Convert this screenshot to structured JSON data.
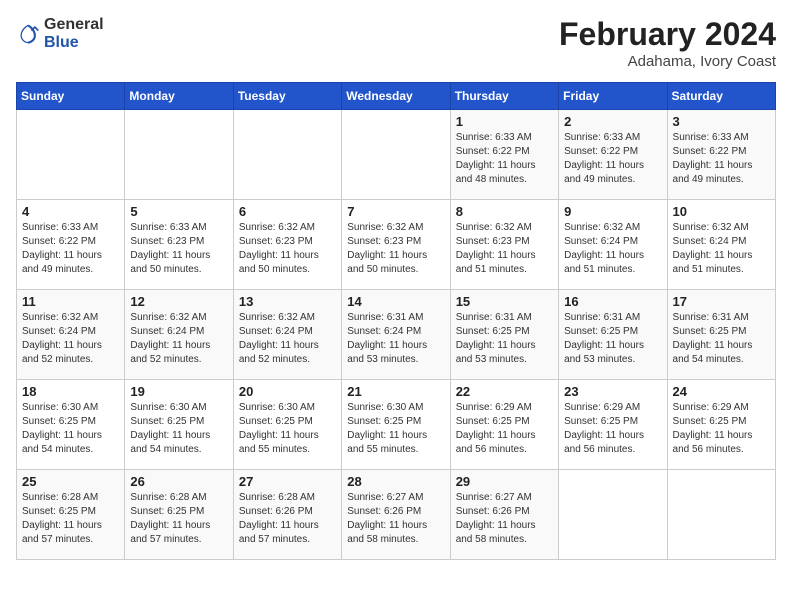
{
  "header": {
    "logo_general": "General",
    "logo_blue": "Blue",
    "month_year": "February 2024",
    "location": "Adahama, Ivory Coast"
  },
  "weekdays": [
    "Sunday",
    "Monday",
    "Tuesday",
    "Wednesday",
    "Thursday",
    "Friday",
    "Saturday"
  ],
  "weeks": [
    [
      {
        "day": "",
        "info": ""
      },
      {
        "day": "",
        "info": ""
      },
      {
        "day": "",
        "info": ""
      },
      {
        "day": "",
        "info": ""
      },
      {
        "day": "1",
        "info": "Sunrise: 6:33 AM\nSunset: 6:22 PM\nDaylight: 11 hours\nand 48 minutes."
      },
      {
        "day": "2",
        "info": "Sunrise: 6:33 AM\nSunset: 6:22 PM\nDaylight: 11 hours\nand 49 minutes."
      },
      {
        "day": "3",
        "info": "Sunrise: 6:33 AM\nSunset: 6:22 PM\nDaylight: 11 hours\nand 49 minutes."
      }
    ],
    [
      {
        "day": "4",
        "info": "Sunrise: 6:33 AM\nSunset: 6:22 PM\nDaylight: 11 hours\nand 49 minutes."
      },
      {
        "day": "5",
        "info": "Sunrise: 6:33 AM\nSunset: 6:23 PM\nDaylight: 11 hours\nand 50 minutes."
      },
      {
        "day": "6",
        "info": "Sunrise: 6:32 AM\nSunset: 6:23 PM\nDaylight: 11 hours\nand 50 minutes."
      },
      {
        "day": "7",
        "info": "Sunrise: 6:32 AM\nSunset: 6:23 PM\nDaylight: 11 hours\nand 50 minutes."
      },
      {
        "day": "8",
        "info": "Sunrise: 6:32 AM\nSunset: 6:23 PM\nDaylight: 11 hours\nand 51 minutes."
      },
      {
        "day": "9",
        "info": "Sunrise: 6:32 AM\nSunset: 6:24 PM\nDaylight: 11 hours\nand 51 minutes."
      },
      {
        "day": "10",
        "info": "Sunrise: 6:32 AM\nSunset: 6:24 PM\nDaylight: 11 hours\nand 51 minutes."
      }
    ],
    [
      {
        "day": "11",
        "info": "Sunrise: 6:32 AM\nSunset: 6:24 PM\nDaylight: 11 hours\nand 52 minutes."
      },
      {
        "day": "12",
        "info": "Sunrise: 6:32 AM\nSunset: 6:24 PM\nDaylight: 11 hours\nand 52 minutes."
      },
      {
        "day": "13",
        "info": "Sunrise: 6:32 AM\nSunset: 6:24 PM\nDaylight: 11 hours\nand 52 minutes."
      },
      {
        "day": "14",
        "info": "Sunrise: 6:31 AM\nSunset: 6:24 PM\nDaylight: 11 hours\nand 53 minutes."
      },
      {
        "day": "15",
        "info": "Sunrise: 6:31 AM\nSunset: 6:25 PM\nDaylight: 11 hours\nand 53 minutes."
      },
      {
        "day": "16",
        "info": "Sunrise: 6:31 AM\nSunset: 6:25 PM\nDaylight: 11 hours\nand 53 minutes."
      },
      {
        "day": "17",
        "info": "Sunrise: 6:31 AM\nSunset: 6:25 PM\nDaylight: 11 hours\nand 54 minutes."
      }
    ],
    [
      {
        "day": "18",
        "info": "Sunrise: 6:30 AM\nSunset: 6:25 PM\nDaylight: 11 hours\nand 54 minutes."
      },
      {
        "day": "19",
        "info": "Sunrise: 6:30 AM\nSunset: 6:25 PM\nDaylight: 11 hours\nand 54 minutes."
      },
      {
        "day": "20",
        "info": "Sunrise: 6:30 AM\nSunset: 6:25 PM\nDaylight: 11 hours\nand 55 minutes."
      },
      {
        "day": "21",
        "info": "Sunrise: 6:30 AM\nSunset: 6:25 PM\nDaylight: 11 hours\nand 55 minutes."
      },
      {
        "day": "22",
        "info": "Sunrise: 6:29 AM\nSunset: 6:25 PM\nDaylight: 11 hours\nand 56 minutes."
      },
      {
        "day": "23",
        "info": "Sunrise: 6:29 AM\nSunset: 6:25 PM\nDaylight: 11 hours\nand 56 minutes."
      },
      {
        "day": "24",
        "info": "Sunrise: 6:29 AM\nSunset: 6:25 PM\nDaylight: 11 hours\nand 56 minutes."
      }
    ],
    [
      {
        "day": "25",
        "info": "Sunrise: 6:28 AM\nSunset: 6:25 PM\nDaylight: 11 hours\nand 57 minutes."
      },
      {
        "day": "26",
        "info": "Sunrise: 6:28 AM\nSunset: 6:25 PM\nDaylight: 11 hours\nand 57 minutes."
      },
      {
        "day": "27",
        "info": "Sunrise: 6:28 AM\nSunset: 6:26 PM\nDaylight: 11 hours\nand 57 minutes."
      },
      {
        "day": "28",
        "info": "Sunrise: 6:27 AM\nSunset: 6:26 PM\nDaylight: 11 hours\nand 58 minutes."
      },
      {
        "day": "29",
        "info": "Sunrise: 6:27 AM\nSunset: 6:26 PM\nDaylight: 11 hours\nand 58 minutes."
      },
      {
        "day": "",
        "info": ""
      },
      {
        "day": "",
        "info": ""
      }
    ]
  ]
}
